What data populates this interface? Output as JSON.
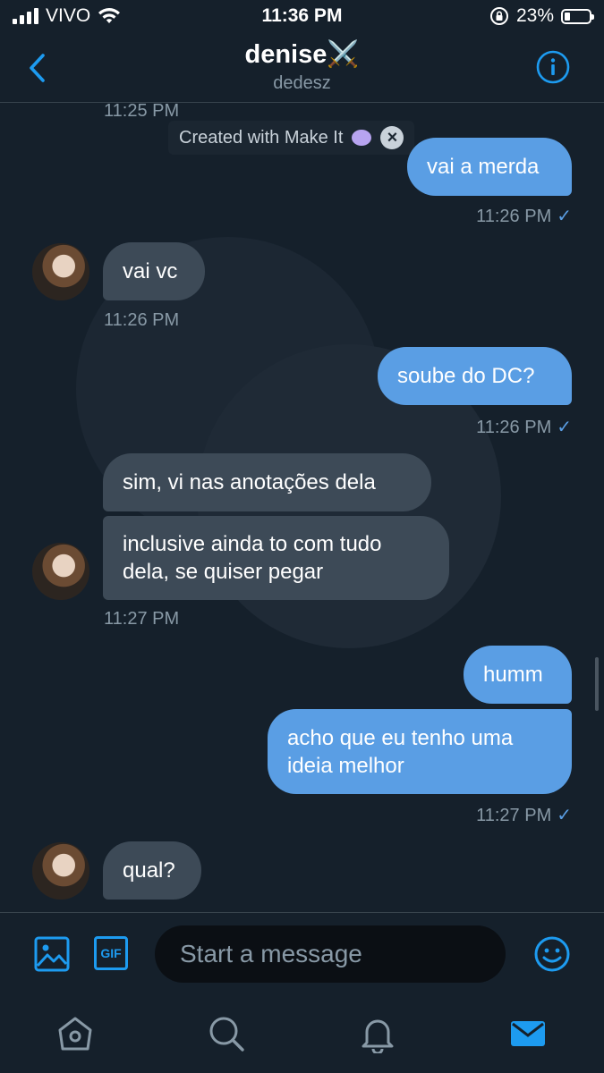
{
  "status_bar": {
    "carrier": "VIVO",
    "time": "11:36 PM",
    "battery": "23%",
    "battery_level": 0.23
  },
  "header": {
    "title": "denise⚔️",
    "subtitle": "dedesz"
  },
  "overlay": {
    "text": "Created with Make It"
  },
  "messages": [
    {
      "top_time": "11:25 PM"
    },
    {
      "text": "vai a merda",
      "time": "11:26 PM",
      "check": "✓"
    },
    {
      "text": "vai vc",
      "time": "11:26 PM"
    },
    {
      "text": "soube do DC?",
      "time": "11:26 PM",
      "check": "✓"
    },
    {
      "text": "sim, vi nas anotações dela"
    },
    {
      "text_l1": "inclusive ainda to com tudo",
      "text_l2": "dela, se quiser pegar",
      "time": "11:27 PM"
    },
    {
      "text": "humm"
    },
    {
      "text_l1": "acho que eu tenho uma",
      "text_l2": "ideia melhor",
      "time": "11:27 PM",
      "check": "✓"
    },
    {
      "text": "qual?"
    }
  ],
  "composer": {
    "placeholder": "Start a message",
    "gif_label": "GIF"
  },
  "colors": {
    "background": "#15202b",
    "outgoing": "#5a9ee4",
    "incoming": "#3d4a57",
    "accent": "#1d9bf0"
  },
  "icons": [
    "back-arrow-icon",
    "info-icon",
    "image-icon",
    "gif-icon",
    "emoji-icon",
    "home-icon",
    "search-icon",
    "bell-icon",
    "mail-icon"
  ]
}
